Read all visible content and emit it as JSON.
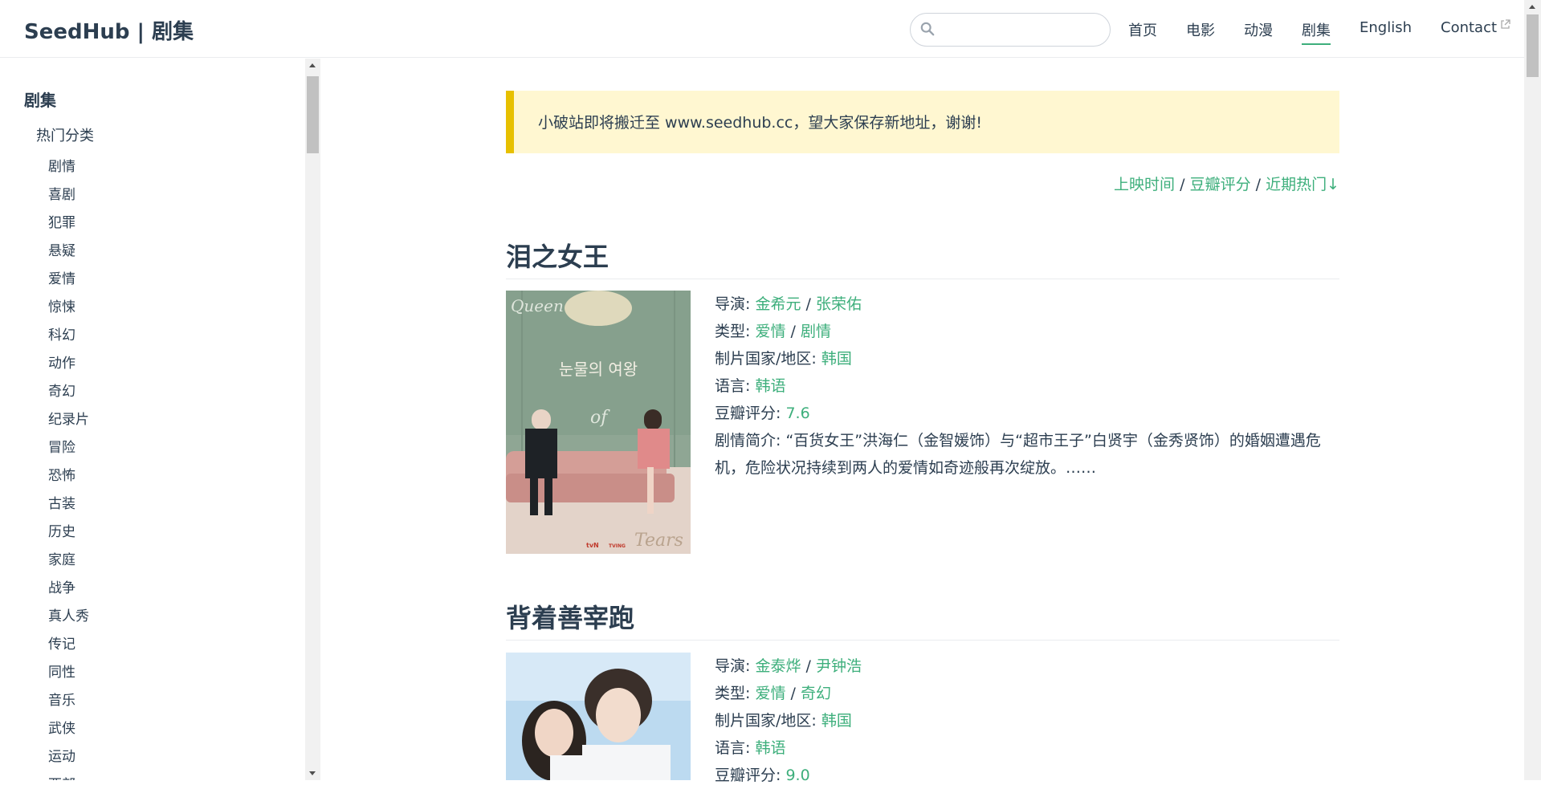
{
  "header": {
    "site_name": "SeedHub | 剧集",
    "search": {
      "placeholder": "",
      "value": ""
    },
    "nav": [
      "首页",
      "电影",
      "动漫",
      "剧集",
      "English",
      "Contact"
    ],
    "active_nav": "剧集"
  },
  "sidebar": {
    "title": "剧集",
    "group": "热门分类",
    "items": [
      "剧情",
      "喜剧",
      "犯罪",
      "悬疑",
      "爱情",
      "惊悚",
      "科幻",
      "动作",
      "奇幻",
      "纪录片",
      "冒险",
      "恐怖",
      "古装",
      "历史",
      "家庭",
      "战争",
      "真人秀",
      "传记",
      "同性",
      "音乐",
      "武侠",
      "运动",
      "西部"
    ]
  },
  "notice": "小破站即将搬迁至 www.seedhub.cc，望大家保存新地址，谢谢!",
  "sort": {
    "release": "上映时间",
    "rating": "豆瓣评分",
    "hot": "近期热门↓",
    "sep": "/"
  },
  "labels": {
    "director": "导演: ",
    "genre": "类型: ",
    "country": "制片国家/地区: ",
    "language": "语言: ",
    "rating": "豆瓣评分: ",
    "summary": "剧情简介: ",
    "sep": " / "
  },
  "items": [
    {
      "title": "泪之女王",
      "directors": [
        "金希元",
        "张荣佑"
      ],
      "genres": [
        "爱情",
        "剧情"
      ],
      "country": "韩国",
      "language": "韩语",
      "rating": "7.6",
      "summary": "“百货女王”洪海仁（金智媛饰）与“超市王子”白贤宇（金秀贤饰）的婚姻遭遇危机，危险状况持续到两人的爱情如奇迹般再次绽放。……",
      "poster_text": {
        "script": "Queen",
        "korean": "눈물의 여왕",
        "of": "of",
        "tears": "Tears",
        "channel": "tvN",
        "tving": "TVING"
      }
    },
    {
      "title": "背着善宰跑",
      "directors": [
        "金泰烨",
        "尹钟浩"
      ],
      "genres": [
        "爱情",
        "奇幻"
      ],
      "country": "韩国",
      "language": "韩语",
      "rating": "9.0"
    }
  ],
  "colors": {
    "accent": "#3eaf7c",
    "text": "#2c3e50",
    "notice_bg": "#fff7d1",
    "notice_border": "#e7c000"
  }
}
